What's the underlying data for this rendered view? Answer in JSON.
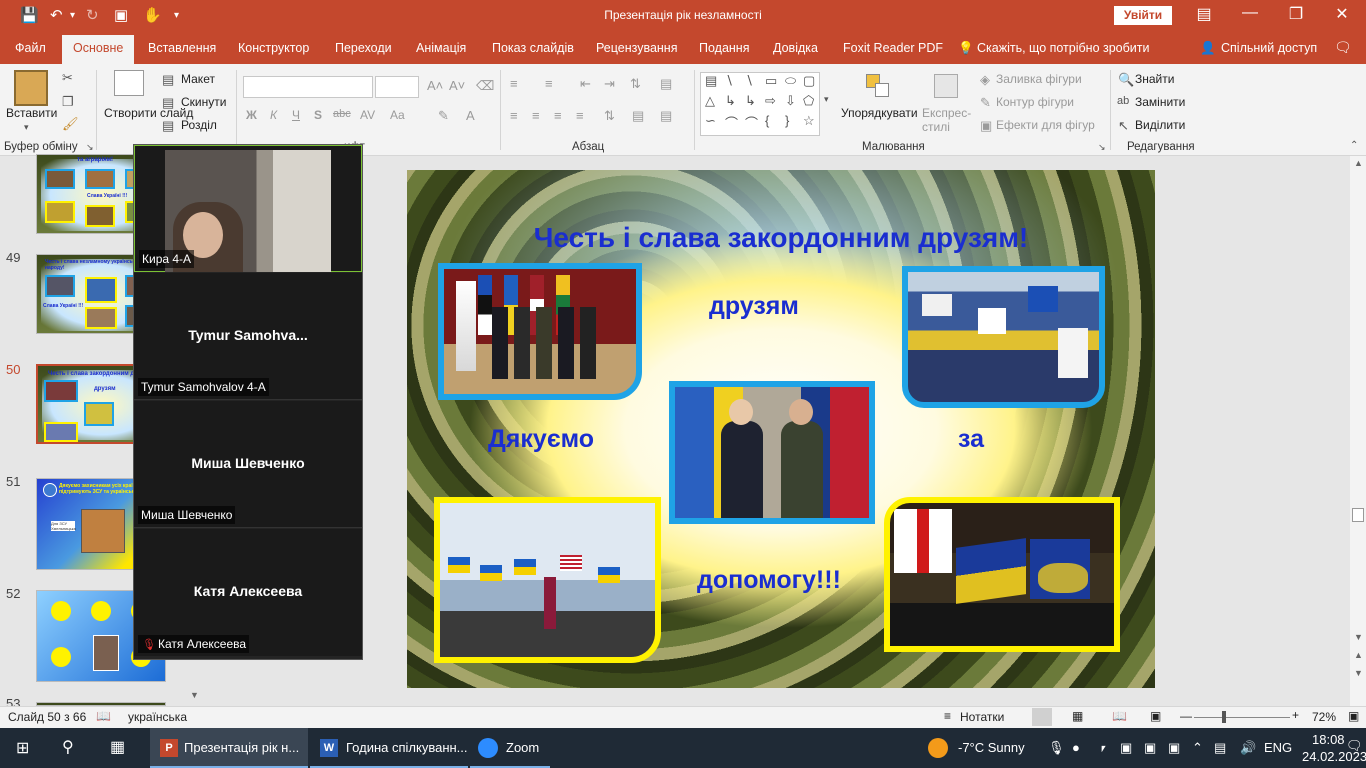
{
  "window": {
    "title": "Презентація рік незламності",
    "signin": "Увійти"
  },
  "tabs": [
    "Файл",
    "Основне",
    "Вставлення",
    "Конструктор",
    "Переходи",
    "Анімація",
    "Показ слайдів",
    "Рецензування",
    "Подання",
    "Довідка",
    "Foxit Reader PDF",
    "Скажіть, що потрібно зробити",
    "Спільний доступ"
  ],
  "ribbon": {
    "paste": "Вставити",
    "clipboard_group": "Буфер обміну",
    "new_slide": "Створити слайд",
    "layout": "Макет",
    "reset": "Скинути",
    "section": "Розділ",
    "font_group_tail": "ифт",
    "paragraph_group": "Абзац",
    "arrange": "Упорядкувати",
    "quick_styles": "Експрес-стилі",
    "shape_fill": "Заливка фігури",
    "shape_outline": "Контур фігури",
    "shape_effects": "Ефекти для фігур",
    "drawing_group": "Малювання",
    "find": "Знайти",
    "replace": "Замінити",
    "select": "Виділити",
    "editing_group": "Редагування",
    "bold": "Ж",
    "italic": "К",
    "underline": "Ч",
    "strike": "S",
    "abc": "abc",
    "spacing": "AV",
    "case": "Aa"
  },
  "thumbnails": [
    {
      "num": "",
      "caption": "та аграріям!",
      "caption2": "Слава Україні !!!"
    },
    {
      "num": "49",
      "caption": "Честь і слава незламному українському народу!",
      "caption2": "Слава Україні !!!"
    },
    {
      "num": "50",
      "caption": "Честь і слава закордонним дру...",
      "caption2": "друзям"
    },
    {
      "num": "51",
      "caption": "Дякуємо захисникам усіх країн, що підтримують ЗСУ та український народ",
      "caption2": "Для ЗСУ Хмельницька"
    },
    {
      "num": "52",
      "caption": "",
      "caption2": ""
    },
    {
      "num": "53",
      "caption": "",
      "caption2": ""
    }
  ],
  "zoom": {
    "participants": [
      {
        "name": "Кира 4-А",
        "big": ""
      },
      {
        "name": "Tymur Samohvalov 4-A",
        "big": "Tymur  Samohva..."
      },
      {
        "name": "Миша Шевченко",
        "big": "Миша Шевченко"
      },
      {
        "name": "Катя Алексеева",
        "big": "Катя Алексеева"
      }
    ]
  },
  "slide": {
    "title": "Честь і слава закордонним друзям!",
    "word1": "друзям",
    "word2": "Дякуємо",
    "word3": "за",
    "word4": "допомогу!!!"
  },
  "status": {
    "slide_info": "Слайд 50 з 66",
    "language": "українська",
    "notes": "Нотатки",
    "zoom_percent": "72%"
  },
  "taskbar": {
    "apps": [
      "Презентація рік н...",
      "Година спілкуванн...",
      "Zoom"
    ],
    "weather": "-7°C  Sunny",
    "lang": "ENG",
    "time": "18:08",
    "date": "24.02.2023"
  },
  "colors": {
    "accent": "#c4482d",
    "slide_text": "#1a2ed0",
    "frame_blue": "#1fa3e6",
    "frame_yellow": "#fff200"
  }
}
